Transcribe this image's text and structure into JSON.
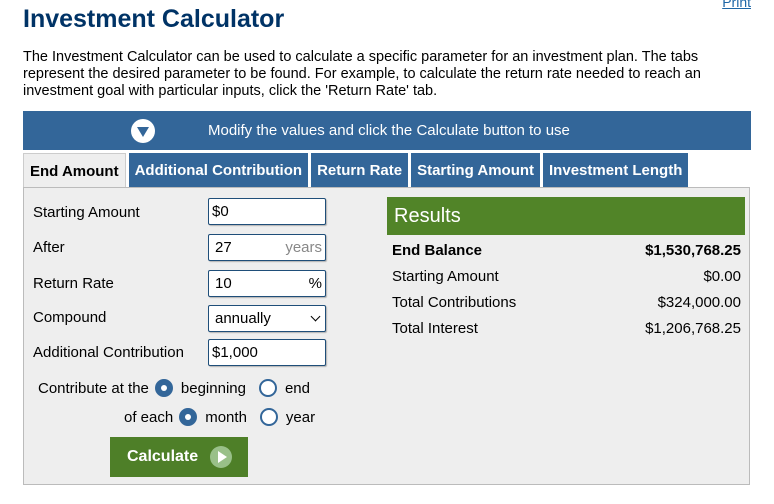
{
  "header": {
    "print_label": "Print",
    "title": "Investment Calculator",
    "intro": "The Investment Calculator can be used to calculate a specific parameter for an investment plan. The tabs represent the desired parameter to be found. For example, to calculate the return rate needed to reach an investment goal with particular inputs, click the 'Return Rate' tab."
  },
  "banner": {
    "icon": "chevron-down-circle-icon",
    "text": "Modify the values and click the Calculate button to use"
  },
  "tabs": [
    {
      "label": "End Amount",
      "active": true
    },
    {
      "label": "Additional Contribution",
      "active": false
    },
    {
      "label": "Return Rate",
      "active": false
    },
    {
      "label": "Starting Amount",
      "active": false
    },
    {
      "label": "Investment Length",
      "active": false
    }
  ],
  "form": {
    "starting_amount": {
      "label": "Starting Amount",
      "value": "$0"
    },
    "after": {
      "label": "After",
      "value": "27",
      "unit": "years"
    },
    "return_rate": {
      "label": "Return Rate",
      "value": "10",
      "unit": "%"
    },
    "compound": {
      "label": "Compound",
      "value": "annually"
    },
    "additional_contribution": {
      "label": "Additional Contribution",
      "value": "$1,000"
    },
    "contribute_at": {
      "label": "Contribute at the",
      "options": [
        "beginning",
        "end"
      ],
      "selected": "beginning"
    },
    "of_each": {
      "label": "of each",
      "options": [
        "month",
        "year"
      ],
      "selected": "month"
    },
    "calculate_label": "Calculate"
  },
  "results": {
    "title": "Results",
    "rows": [
      {
        "label": "End Balance",
        "value": "$1,530,768.25"
      },
      {
        "label": "Starting Amount",
        "value": "$0.00"
      },
      {
        "label": "Total Contributions",
        "value": "$324,000.00"
      },
      {
        "label": "Total Interest",
        "value": "$1,206,768.25"
      }
    ]
  },
  "colors": {
    "brand_blue": "#336699",
    "title_navy": "#003366",
    "result_green": "#518428",
    "button_green": "#4e7f28",
    "panel_gray": "#eeeeee"
  }
}
